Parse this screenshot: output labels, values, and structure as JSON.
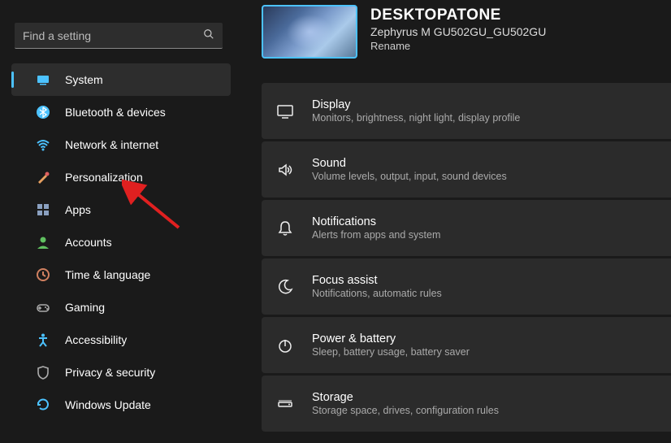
{
  "search": {
    "placeholder": "Find a setting"
  },
  "nav": [
    {
      "label": "System",
      "icon": "system",
      "active": true
    },
    {
      "label": "Bluetooth & devices",
      "icon": "bluetooth",
      "active": false
    },
    {
      "label": "Network & internet",
      "icon": "wifi",
      "active": false
    },
    {
      "label": "Personalization",
      "icon": "brush",
      "active": false
    },
    {
      "label": "Apps",
      "icon": "apps",
      "active": false
    },
    {
      "label": "Accounts",
      "icon": "person",
      "active": false
    },
    {
      "label": "Time & language",
      "icon": "clock",
      "active": false
    },
    {
      "label": "Gaming",
      "icon": "gamepad",
      "active": false
    },
    {
      "label": "Accessibility",
      "icon": "accessibility",
      "active": false
    },
    {
      "label": "Privacy & security",
      "icon": "shield",
      "active": false
    },
    {
      "label": "Windows Update",
      "icon": "update",
      "active": false
    }
  ],
  "device": {
    "name": "DESKTOPATONE",
    "model": "Zephyrus M GU502GU_GU502GU",
    "rename": "Rename"
  },
  "items": [
    {
      "title": "Display",
      "desc": "Monitors, brightness, night light, display profile",
      "icon": "display"
    },
    {
      "title": "Sound",
      "desc": "Volume levels, output, input, sound devices",
      "icon": "sound"
    },
    {
      "title": "Notifications",
      "desc": "Alerts from apps and system",
      "icon": "bell"
    },
    {
      "title": "Focus assist",
      "desc": "Notifications, automatic rules",
      "icon": "moon"
    },
    {
      "title": "Power & battery",
      "desc": "Sleep, battery usage, battery saver",
      "icon": "power"
    },
    {
      "title": "Storage",
      "desc": "Storage space, drives, configuration rules",
      "icon": "storage"
    }
  ],
  "icons": {
    "system": "#4cc2ff",
    "bluetooth": "#4cc2ff",
    "wifi": "#4cc2ff",
    "brush": "#e6a060",
    "apps": "#8aa0c0",
    "person": "#60c060",
    "clock": "#d08060",
    "gamepad": "#aaaaaa",
    "accessibility": "#4cc2ff",
    "shield": "#aaaaaa",
    "update": "#4cc2ff"
  }
}
